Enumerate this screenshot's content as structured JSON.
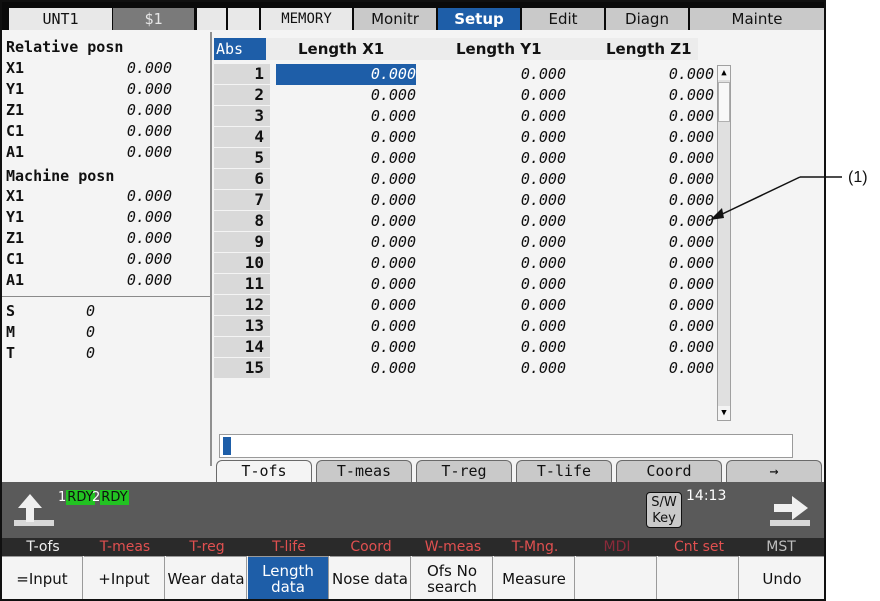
{
  "topbar": {
    "unit": "UNT1",
    "system": "$1",
    "mode": "MEMORY",
    "menus": [
      {
        "label": "Monitr",
        "active": false
      },
      {
        "label": "Setup",
        "active": true
      },
      {
        "label": "Edit",
        "active": false
      },
      {
        "label": "Diagn",
        "active": false
      },
      {
        "label": "Mainte",
        "active": false
      }
    ]
  },
  "relative": {
    "title": "Relative posn",
    "rows": [
      {
        "axis": "X1",
        "value": "0.000"
      },
      {
        "axis": "Y1",
        "value": "0.000"
      },
      {
        "axis": "Z1",
        "value": "0.000"
      },
      {
        "axis": "C1",
        "value": "0.000"
      },
      {
        "axis": "A1",
        "value": "0.000"
      }
    ]
  },
  "machine": {
    "title": "Machine posn",
    "rows": [
      {
        "axis": "X1",
        "value": "0.000"
      },
      {
        "axis": "Y1",
        "value": "0.000"
      },
      {
        "axis": "Z1",
        "value": "0.000"
      },
      {
        "axis": "C1",
        "value": "0.000"
      },
      {
        "axis": "A1",
        "value": "0.000"
      }
    ]
  },
  "mst": [
    {
      "code": "S",
      "value": "0"
    },
    {
      "code": "M",
      "value": "0"
    },
    {
      "code": "T",
      "value": "0"
    }
  ],
  "table": {
    "abs_label": "Abs",
    "headers": [
      "Length X1",
      "Length Y1",
      "Length Z1"
    ],
    "selected_row": 1,
    "rows": [
      {
        "no": "1",
        "x": "0.000",
        "y": "0.000",
        "z": "0.000"
      },
      {
        "no": "2",
        "x": "0.000",
        "y": "0.000",
        "z": "0.000"
      },
      {
        "no": "3",
        "x": "0.000",
        "y": "0.000",
        "z": "0.000"
      },
      {
        "no": "4",
        "x": "0.000",
        "y": "0.000",
        "z": "0.000"
      },
      {
        "no": "5",
        "x": "0.000",
        "y": "0.000",
        "z": "0.000"
      },
      {
        "no": "6",
        "x": "0.000",
        "y": "0.000",
        "z": "0.000"
      },
      {
        "no": "7",
        "x": "0.000",
        "y": "0.000",
        "z": "0.000"
      },
      {
        "no": "8",
        "x": "0.000",
        "y": "0.000",
        "z": "0.000"
      },
      {
        "no": "9",
        "x": "0.000",
        "y": "0.000",
        "z": "0.000"
      },
      {
        "no": "10",
        "x": "0.000",
        "y": "0.000",
        "z": "0.000"
      },
      {
        "no": "11",
        "x": "0.000",
        "y": "0.000",
        "z": "0.000"
      },
      {
        "no": "12",
        "x": "0.000",
        "y": "0.000",
        "z": "0.000"
      },
      {
        "no": "13",
        "x": "0.000",
        "y": "0.000",
        "z": "0.000"
      },
      {
        "no": "14",
        "x": "0.000",
        "y": "0.000",
        "z": "0.000"
      },
      {
        "no": "15",
        "x": "0.000",
        "y": "0.000",
        "z": "0.000"
      }
    ]
  },
  "tabs": [
    {
      "label": "T-ofs",
      "active": true
    },
    {
      "label": "T-meas",
      "active": false
    },
    {
      "label": "T-reg",
      "active": false
    },
    {
      "label": "T-life",
      "active": false
    },
    {
      "label": "Coord",
      "active": false
    },
    {
      "label": "→",
      "active": false
    }
  ],
  "status": {
    "rdy1_num": "1",
    "rdy1_tag": "RDY",
    "rdy2_num": "2",
    "rdy2_tag": "RDY",
    "swkey": "S/W Key",
    "clock": "14:13"
  },
  "function_menu": [
    {
      "label": "T-ofs",
      "style": "w"
    },
    {
      "label": "T-meas",
      "style": "r"
    },
    {
      "label": "T-reg",
      "style": "r"
    },
    {
      "label": "T-life",
      "style": "r"
    },
    {
      "label": "Coord",
      "style": "r"
    },
    {
      "label": "W-meas",
      "style": "r"
    },
    {
      "label": "T-Mng.",
      "style": "r"
    },
    {
      "label": "MDI",
      "style": "d"
    },
    {
      "label": "Cnt set",
      "style": "r"
    },
    {
      "label": "MST",
      "style": "g"
    }
  ],
  "softkeys": [
    {
      "label": "=Input",
      "active": false
    },
    {
      "label": "+Input",
      "active": false
    },
    {
      "label": "Wear data",
      "active": false
    },
    {
      "label": "Length data",
      "active": true
    },
    {
      "label": "Nose data",
      "active": false
    },
    {
      "label": "Ofs No search",
      "active": false
    },
    {
      "label": "Measure",
      "active": false
    },
    {
      "label": "",
      "active": false
    },
    {
      "label": "",
      "active": false
    },
    {
      "label": "Undo",
      "active": false
    }
  ],
  "callout": "(1)",
  "colors": {
    "accent": "#1e5ea8",
    "rdy_green": "#22c222",
    "menu_red": "#e05050"
  }
}
